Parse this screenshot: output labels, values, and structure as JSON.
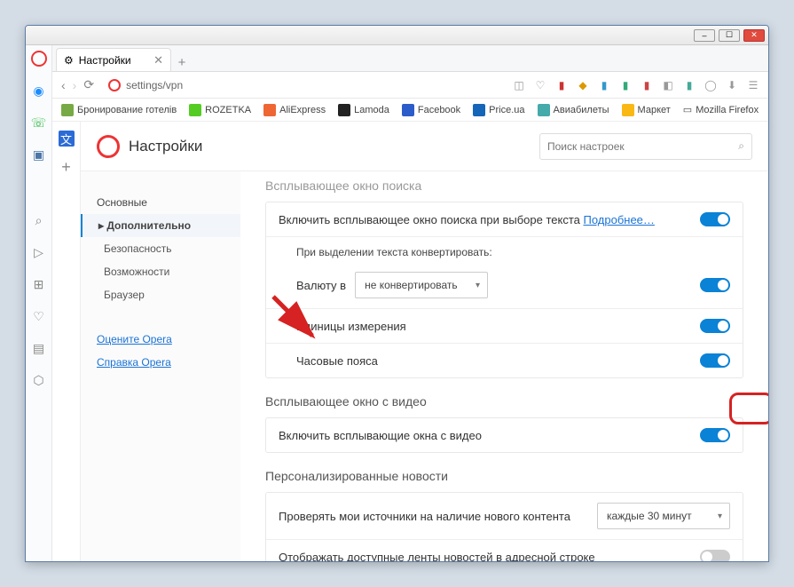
{
  "window": {
    "min": "–",
    "max": "☐",
    "close": "✕"
  },
  "tab": {
    "title": "Настройки",
    "icon": "⚙",
    "close": "✕"
  },
  "addr": {
    "url": "settings/vpn"
  },
  "bookmarks": [
    {
      "label": "Бронирование готелів",
      "c": "#7a4"
    },
    {
      "label": "ROZETKA",
      "c": "#5c2"
    },
    {
      "label": "AliExpress",
      "c": "#e63"
    },
    {
      "label": "Lamoda",
      "c": "#222"
    },
    {
      "label": "Facebook",
      "c": "#2b5cc9"
    },
    {
      "label": "Price.ua",
      "c": "#1566b8"
    },
    {
      "label": "Авиабилеты",
      "c": "#4aa"
    },
    {
      "label": "Маркет",
      "c": "#f9b814"
    },
    {
      "label": "Mozilla Firefox",
      "c": "#f9b814"
    }
  ],
  "hdr": {
    "title": "Настройки",
    "search_ph": "Поиск настроек"
  },
  "nav": {
    "basic": "Основные",
    "adv": "Дополнительно",
    "security": "Безопасность",
    "features": "Возможности",
    "browser": "Браузер",
    "rate": "Оцените Opera",
    "help": "Справка Opera"
  },
  "sections": {
    "s0_title": "Всплывающее окно поиска",
    "s0_r1": "Включить всплывающее окно поиска при выборе текста",
    "s0_more": "Подробнее…",
    "s0_sub": "При выделении текста конвертировать:",
    "s0_r2": "Валюту в",
    "s0_r2_sel": "не конвертировать",
    "s0_r3": "Единицы измерения",
    "s0_r4": "Часовые пояса",
    "s1_title": "Всплывающее окно с видео",
    "s1_r1": "Включить всплывающие окна с видео",
    "s2_title": "Персонализированные новости",
    "s2_r1": "Проверять мои источники на наличие нового контента",
    "s2_r1_sel": "каждые 30 минут",
    "s2_r2": "Отображать доступные ленты новостей в адресной строке"
  }
}
